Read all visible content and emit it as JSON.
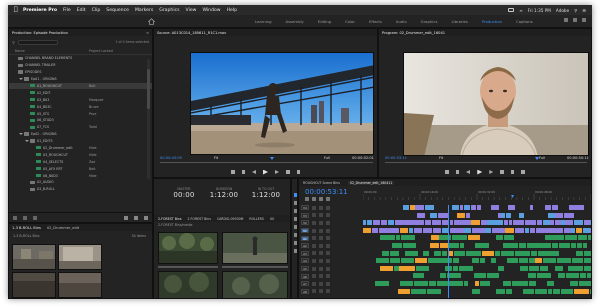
{
  "menubar": {
    "app_name": "Premiere Pro",
    "items": [
      "File",
      "Edit",
      "Clip",
      "Sequence",
      "Markers",
      "Graphics",
      "View",
      "Window",
      "Help"
    ],
    "clock": "Fri 1:35 PM",
    "user": "Adobe"
  },
  "workspaces": {
    "tabs": [
      "Learning",
      "Assembly",
      "Editing",
      "Color",
      "Effects",
      "Audio",
      "Graphics",
      "Libraries",
      "Production",
      "Captions"
    ],
    "active": "Production"
  },
  "project_panel": {
    "title": "Production: Episode Production",
    "search_placeholder": "",
    "item_count": "1 of 4 items selected",
    "columns": [
      "Name",
      "Project Locked"
    ],
    "rows": [
      {
        "name": "CHANNEL BRAND ELEMENTS",
        "type": "folder",
        "indent": 0,
        "col2": ""
      },
      {
        "name": "CHANNEL TRAILER",
        "type": "folder",
        "indent": 0,
        "col2": ""
      },
      {
        "name": "EPISODES",
        "type": "folder",
        "indent": 0,
        "col2": ""
      },
      {
        "name": "Ep01 - ORIGINS",
        "type": "folder-open",
        "indent": 1,
        "col2": ""
      },
      {
        "name": "01_ROUGHCUT",
        "type": "seq",
        "indent": 2,
        "col2": "Bolt",
        "selected": true
      },
      {
        "name": "02_EDIT",
        "type": "seq",
        "indent": 2,
        "col2": ""
      },
      {
        "name": "03_B03",
        "type": "seq",
        "indent": 2,
        "col2": "Marquee"
      },
      {
        "name": "04_B03C",
        "type": "seq",
        "indent": 2,
        "col2": "Bruce"
      },
      {
        "name": "05_STS",
        "type": "seq",
        "indent": 2,
        "col2": "Prue"
      },
      {
        "name": "06_ST0D3",
        "type": "seq",
        "indent": 2,
        "col2": ""
      },
      {
        "name": "07_TCS",
        "type": "seq",
        "indent": 2,
        "col2": "Todd"
      },
      {
        "name": "Ep02 - ORIGINS",
        "type": "folder-open",
        "indent": 1,
        "col2": ""
      },
      {
        "name": "01_EDITS",
        "type": "folder-open",
        "indent": 2,
        "col2": ""
      },
      {
        "name": "02_Drummer_edit",
        "type": "seq",
        "indent": 3,
        "col2": "Hide"
      },
      {
        "name": "03_ROUGHCUT",
        "type": "seq",
        "indent": 3,
        "col2": "Hide"
      },
      {
        "name": "04_SELECTS",
        "type": "seq",
        "indent": 3,
        "col2": "Zoe"
      },
      {
        "name": "05_AFX ERT",
        "type": "seq",
        "indent": 3,
        "col2": "Bolt"
      },
      {
        "name": "06_B0D3",
        "type": "seq",
        "indent": 3,
        "col2": "Hide"
      },
      {
        "name": "02_AUDIO",
        "type": "folder",
        "indent": 2,
        "col2": ""
      },
      {
        "name": "03_B-ROLL",
        "type": "folder",
        "indent": 2,
        "col2": ""
      }
    ]
  },
  "bin_panel": {
    "title": "1-3 B-ROLL Bins",
    "tab2": "02_Drummer_edit",
    "path": "1-3 B-ROLL Bins",
    "count": "54 items",
    "thumbs": [
      {
        "label": "clip_01.mp4",
        "duration": "0:04"
      },
      {
        "label": "clip_02.mp4",
        "duration": "0:06"
      },
      {
        "label": "clip_03.mp4",
        "duration": "0:05"
      },
      {
        "label": "clip_04.mp4",
        "duration": "0:07"
      }
    ]
  },
  "source_monitor": {
    "title": "Source: A013C014_180611_R1C1.mov",
    "tc_in": "00:00:43:05",
    "fit": "Fit",
    "fraction": "Full",
    "tc_dur": "00:00:02:01"
  },
  "program_monitor": {
    "title": "Program: 02_Drummer_edit_16041",
    "tc_in": "00:00:53:11",
    "fit": "Fit",
    "fraction": "Full",
    "tc_dur": "00:00:50:11"
  },
  "effects_panel": {
    "readouts": [
      {
        "key": "MASTER",
        "value": "00:00"
      },
      {
        "key": "DURATION",
        "value": "1:12:00"
      },
      {
        "key": "IN TO OUT",
        "value": "1:12:00"
      }
    ],
    "tabs": [
      "2-FOREST Bins",
      "2 FOREST Bins",
      "CARDIG-09300M",
      "ROLLERS",
      "X0"
    ],
    "active_tab": "2-FOREST Bins",
    "path": "2-FOREST Bins/media",
    "thumbs": [
      {
        "duration": "0:06"
      },
      {
        "duration": "0:05"
      },
      {
        "duration": "0:04"
      },
      {
        "duration": "0:08"
      }
    ]
  },
  "timeline": {
    "tabs": [
      "ROUGHCUT Scene Bins",
      "02_Drummer_edit_160411"
    ],
    "active_tab": "02_Drummer_edit_160411",
    "timecode": "00:00:53:11",
    "ruler_labels": [
      "00:00:00",
      "00:00:16:00",
      "00:00:32:00",
      "00:00:48:00",
      "00:01:04:00"
    ],
    "video_tracks": [
      "V4",
      "V3",
      "V2",
      "V1"
    ],
    "audio_tracks": [
      "A1",
      "A2",
      "A3",
      "A4",
      "A5",
      "A6",
      "A7",
      "A8"
    ],
    "colors": {
      "video": "#8f7fe0",
      "video_alt": "#5aa0e0",
      "audio": "#2e9c5a",
      "audio_hi": "#f0a030",
      "playhead": "#3d8ef7"
    }
  },
  "colors": {
    "accent": "#3d8ef7",
    "panel_bg": "#232323",
    "frame_bg": "#1d1d1d"
  }
}
